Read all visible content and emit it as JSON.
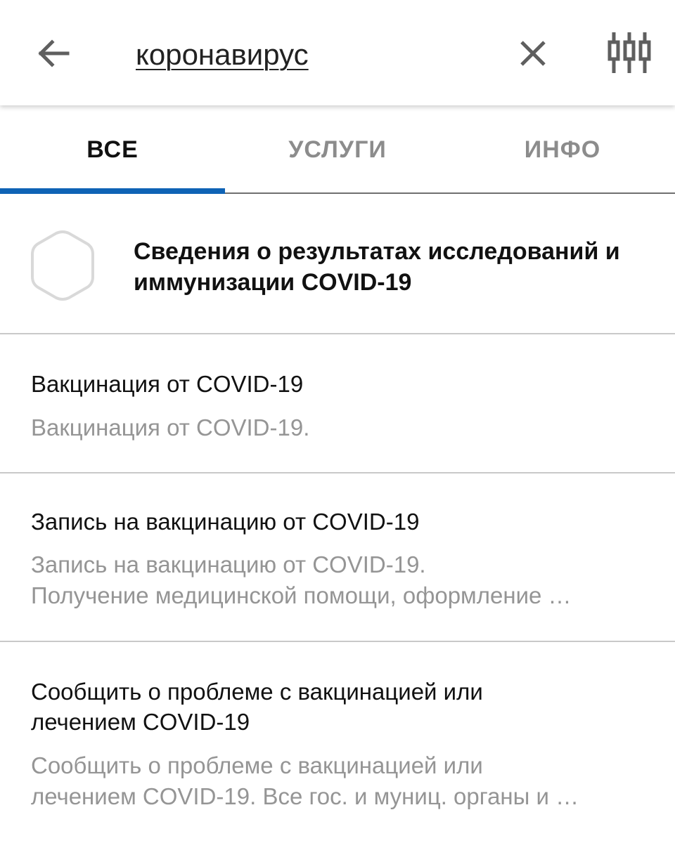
{
  "search": {
    "query": "коронавирус"
  },
  "tabs": [
    {
      "label": "ВСЕ",
      "active": true
    },
    {
      "label": "УСЛУГИ",
      "active": false
    },
    {
      "label": "ИНФО",
      "active": false
    }
  ],
  "featured": {
    "title": "Сведения о результатах исследований и иммунизации COVID-19",
    "icon": "hexagon-icon"
  },
  "results": [
    {
      "title": "Вакцинация от COVID-19",
      "description_lines": [
        "Вакцинация от COVID-19."
      ]
    },
    {
      "title": "Запись на вакцинацию от COVID-19",
      "description_lines": [
        "Запись на вакцинацию от COVID-19.",
        "Получение медицинской помощи, оформление …"
      ]
    },
    {
      "title_lines": [
        "Сообщить о проблеме с вакцинацией или",
        "лечением COVID-19"
      ],
      "description_lines": [
        "Сообщить о проблеме с вакцинацией или",
        "лечением COVID-19. Все гос. и муниц. органы и …"
      ]
    }
  ],
  "colors": {
    "accent": "#0f63b5",
    "muted_text": "#959595",
    "divider": "#c9c9c9"
  },
  "icons": {
    "back": "arrow-left-icon",
    "clear": "close-icon",
    "filter": "filter-sliders-icon"
  }
}
